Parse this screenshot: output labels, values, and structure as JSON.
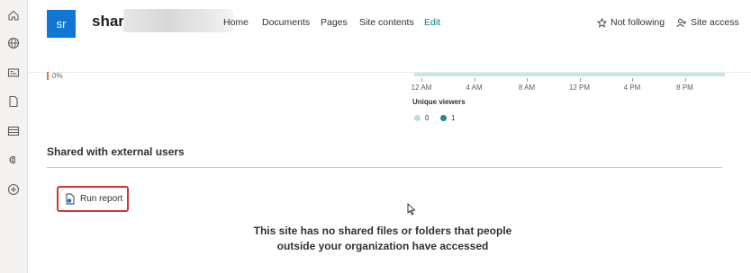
{
  "header": {
    "logo_text": "sr",
    "site_title": "shari",
    "nav": [
      "Home",
      "Documents",
      "Pages",
      "Site contents",
      "Edit"
    ],
    "follow_label": "Not following",
    "site_access_label": "Site access"
  },
  "rail_icons": [
    "home-icon",
    "globe-icon",
    "news-icon",
    "document-icon",
    "list-icon",
    "loop-icon",
    "add-icon"
  ],
  "chart": {
    "percent_label": "0%",
    "x_ticks": [
      "12 AM",
      "4 AM",
      "8 AM",
      "12 PM",
      "4 PM",
      "8 PM"
    ],
    "legend_title": "Unique viewers",
    "legend": [
      {
        "label": "0",
        "color": "#b9e0e0"
      },
      {
        "label": "1",
        "color": "#1f8a8a"
      }
    ]
  },
  "chart_data": {
    "type": "bar",
    "title": "",
    "xlabel": "",
    "ylabel": "",
    "categories": [
      "12 AM",
      "4 AM",
      "8 AM",
      "12 PM",
      "4 PM",
      "8 PM"
    ],
    "series": [
      {
        "name": "0",
        "values": [
          0,
          0,
          0,
          0,
          0,
          0
        ]
      }
    ],
    "legend_title": "Unique viewers",
    "legend_position": "bottom-left"
  },
  "external": {
    "section_title": "Shared with external users",
    "run_report_label": "Run report",
    "empty_message": "This site has no shared files or folders that people outside your organization have accessed"
  }
}
